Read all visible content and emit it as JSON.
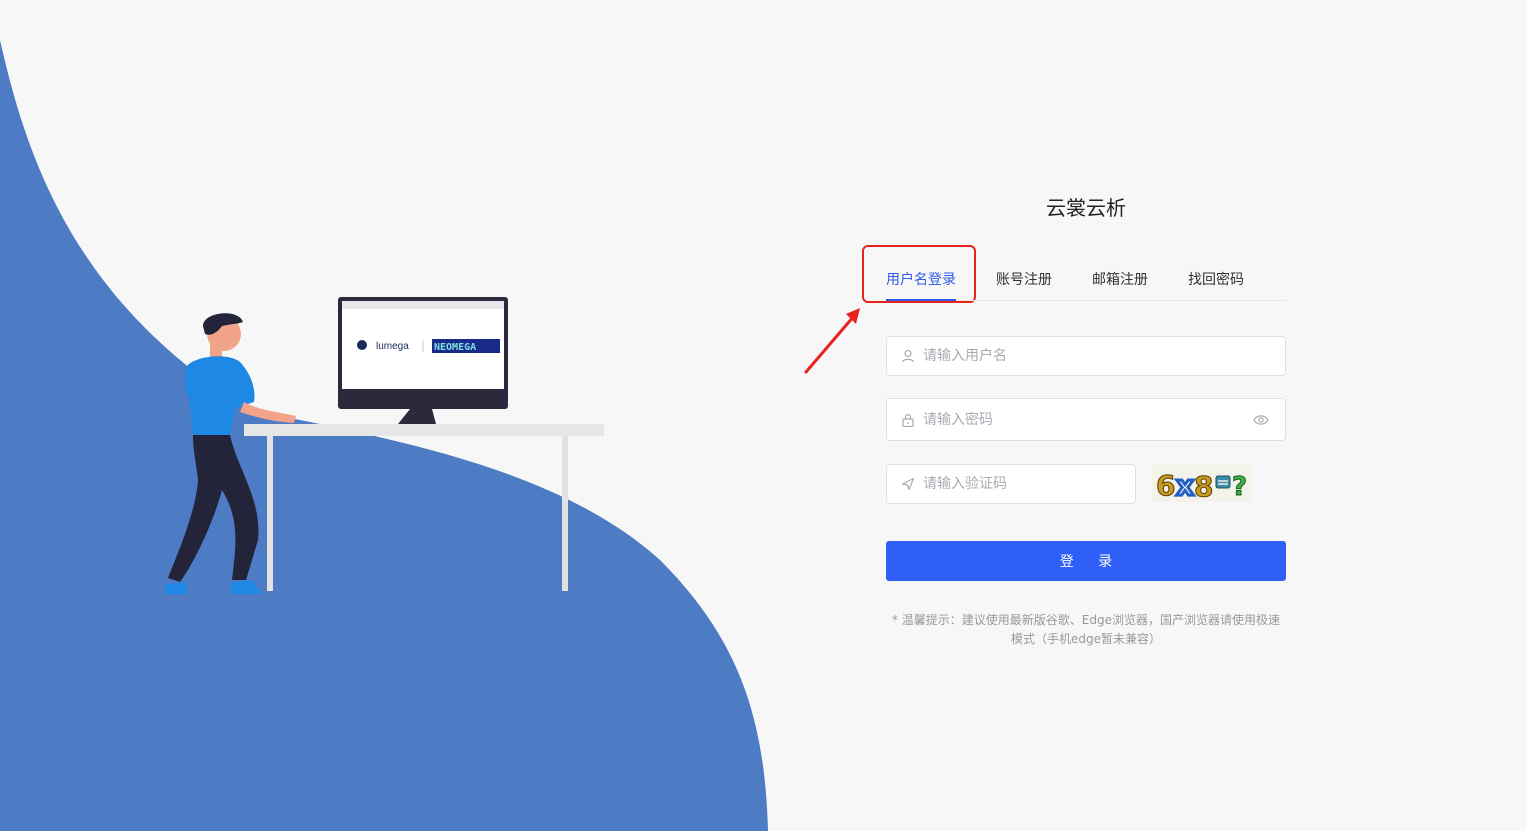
{
  "app": {
    "title": "云裳云析"
  },
  "tabs": [
    {
      "label": "用户名登录",
      "active": true
    },
    {
      "label": "账号注册",
      "active": false
    },
    {
      "label": "邮箱注册",
      "active": false
    },
    {
      "label": "找回密码",
      "active": false
    }
  ],
  "form": {
    "username_placeholder": "请输入用户名",
    "password_placeholder": "请输入密码",
    "captcha_placeholder": "请输入验证码",
    "captcha_text": "6x8=?",
    "login_label": "登 录",
    "tip": "* 温馨提示：建议使用最新版谷歌、Edge浏览器，国产浏览器请使用极速模式（手机edge暂未兼容）"
  },
  "illustration": {
    "monitor_brand_1": "lumega",
    "monitor_brand_2": "NEOMEGA"
  },
  "colors": {
    "primary": "#2f5ff7",
    "active_tab": "#2f5bea",
    "background_shape": "#4d7cc4",
    "annotation": "#e8231e"
  }
}
